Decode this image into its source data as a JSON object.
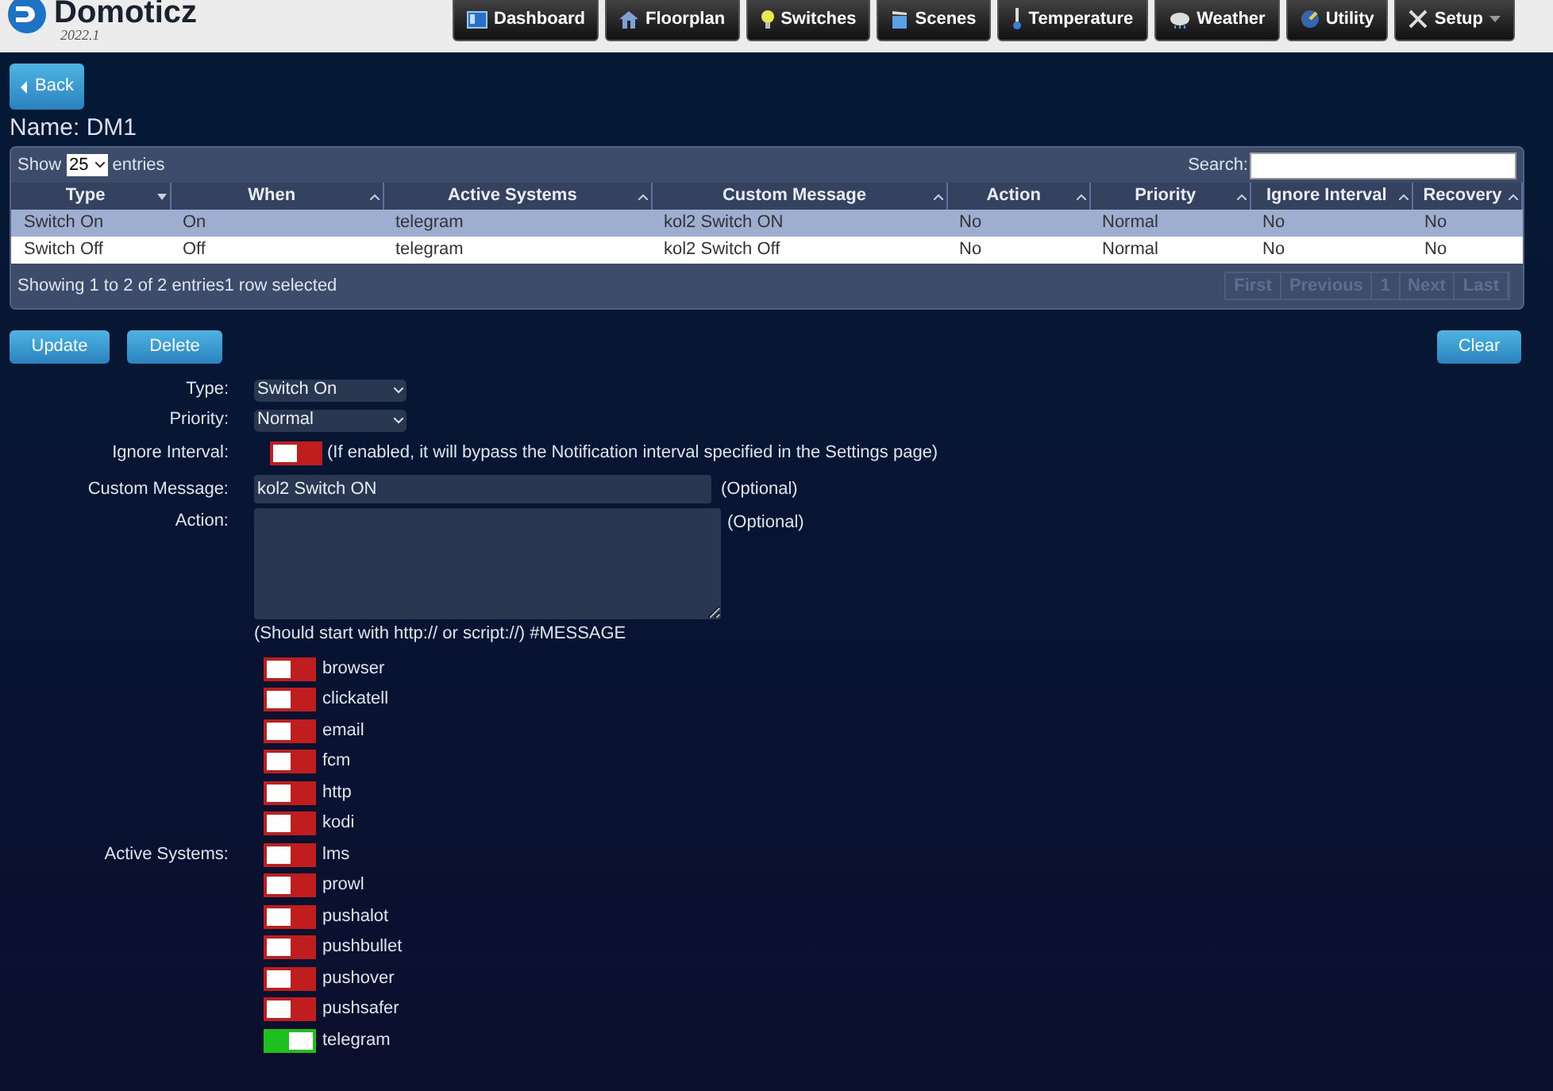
{
  "logo": {
    "name": "Domoticz",
    "version": "2022.1"
  },
  "nav": [
    {
      "label": "Dashboard",
      "kind": "dashboard"
    },
    {
      "label": "Floorplan",
      "kind": "floorplan"
    },
    {
      "label": "Switches",
      "kind": "switches"
    },
    {
      "label": "Scenes",
      "kind": "scenes"
    },
    {
      "label": "Temperature",
      "kind": "temperature"
    },
    {
      "label": "Weather",
      "kind": "weather"
    },
    {
      "label": "Utility",
      "kind": "utility"
    },
    {
      "label": "Setup",
      "kind": "setup",
      "dropdown": true
    }
  ],
  "back_button": "Back",
  "title": "Name: DM1",
  "table": {
    "show_label": "Show",
    "page_size": "25",
    "entries_label": "entries",
    "search_label": "Search:",
    "columns": [
      "Type",
      "When",
      "Active Systems",
      "Custom Message",
      "Action",
      "Priority",
      "Ignore Interval",
      "Recovery"
    ],
    "rows": [
      {
        "cells": [
          "Switch On",
          "On",
          "telegram",
          "kol2 Switch ON",
          "No",
          "Normal",
          "No",
          "No"
        ],
        "selected": true
      },
      {
        "cells": [
          "Switch Off",
          "Off",
          "telegram",
          "kol2 Switch Off",
          "No",
          "Normal",
          "No",
          "No"
        ],
        "selected": false
      }
    ],
    "info": "Showing 1 to 2 of 2 entries1 row selected",
    "pager": [
      "First",
      "Previous",
      "1",
      "Next",
      "Last"
    ]
  },
  "buttons": {
    "update": "Update",
    "delete": "Delete",
    "clear": "Clear"
  },
  "form": {
    "type": {
      "label": "Type:",
      "value": "Switch On"
    },
    "priority": {
      "label": "Priority:",
      "value": "Normal"
    },
    "ignore_interval": {
      "label": "Ignore Interval:",
      "on": false,
      "note": "(If enabled, it will bypass the Notification interval specified in the Settings page)"
    },
    "custom_message": {
      "label": "Custom Message:",
      "value": "kol2 Switch ON",
      "note": "(Optional)"
    },
    "action": {
      "label": "Action:",
      "note": "(Optional)",
      "hint": "(Should start with http:// or script://) #MESSAGE"
    },
    "active_systems": {
      "label": "Active Systems:",
      "items": [
        {
          "name": "browser",
          "on": false
        },
        {
          "name": "clickatell",
          "on": false
        },
        {
          "name": "email",
          "on": false
        },
        {
          "name": "fcm",
          "on": false
        },
        {
          "name": "http",
          "on": false
        },
        {
          "name": "kodi",
          "on": false
        },
        {
          "name": "lms",
          "on": false
        },
        {
          "name": "prowl",
          "on": false
        },
        {
          "name": "pushalot",
          "on": false
        },
        {
          "name": "pushbullet",
          "on": false
        },
        {
          "name": "pushover",
          "on": false
        },
        {
          "name": "pushsafer",
          "on": false
        },
        {
          "name": "telegram",
          "on": true
        }
      ]
    }
  }
}
